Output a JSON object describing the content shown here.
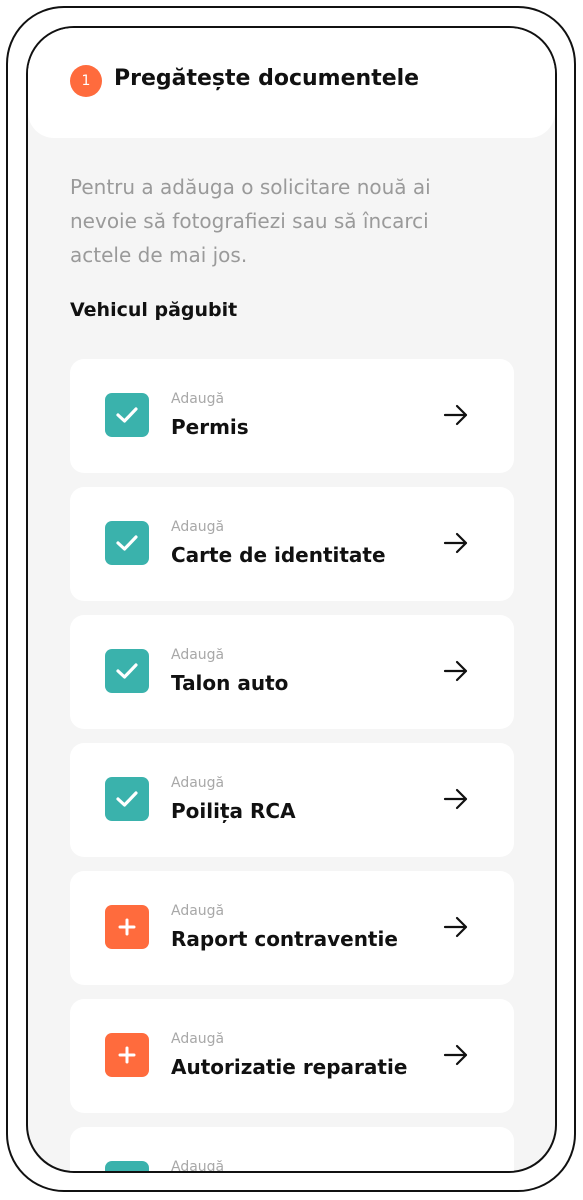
{
  "header": {
    "step_number": "1",
    "title": "Pregătește documentele"
  },
  "intro_text": "Pentru a adăuga o solicitare nouă ai nevoie să fotografiezi sau să încarci actele de mai jos.",
  "section": {
    "title": "Vehicul păgubit"
  },
  "colors": {
    "accent_orange": "#ff6b3d",
    "accent_teal": "#3ab2ac"
  },
  "documents": [
    {
      "sub": "Adaugă",
      "label": "Permis",
      "status": "check-icon"
    },
    {
      "sub": "Adaugă",
      "label": "Carte de identitate",
      "status": "check-icon"
    },
    {
      "sub": "Adaugă",
      "label": "Talon auto",
      "status": "check-icon"
    },
    {
      "sub": "Adaugă",
      "label": "Poilița RCA",
      "status": "check-icon"
    },
    {
      "sub": "Adaugă",
      "label": "Raport contraventie",
      "status": "plus-icon"
    },
    {
      "sub": "Adaugă",
      "label": "Autorizatie reparatie",
      "status": "plus-icon"
    },
    {
      "sub": "Adaugă",
      "label": "",
      "status": "check-icon"
    }
  ]
}
